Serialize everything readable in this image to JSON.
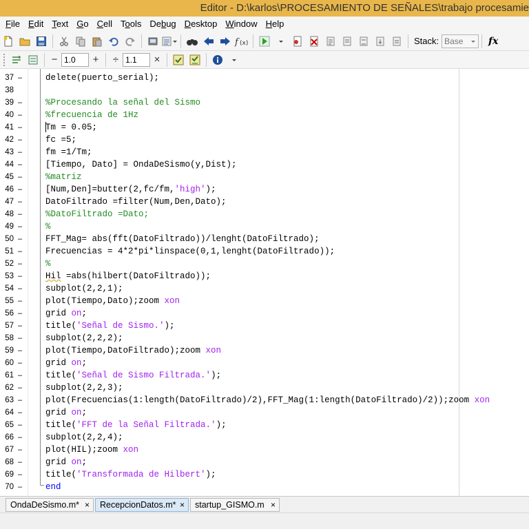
{
  "window": {
    "title": "Editor - D:\\karlos\\PROCESAMIENTO DE SEÑALES\\trabajo procesamie"
  },
  "menu": [
    {
      "pre": "",
      "u": "F",
      "post": "ile"
    },
    {
      "pre": "",
      "u": "E",
      "post": "dit"
    },
    {
      "pre": "",
      "u": "T",
      "post": "ext"
    },
    {
      "pre": "",
      "u": "G",
      "post": "o"
    },
    {
      "pre": "",
      "u": "C",
      "post": "ell"
    },
    {
      "pre": "T",
      "u": "o",
      "post": "ols"
    },
    {
      "pre": "De",
      "u": "b",
      "post": "ug"
    },
    {
      "pre": "",
      "u": "D",
      "post": "esktop"
    },
    {
      "pre": "",
      "u": "W",
      "post": "indow"
    },
    {
      "pre": "",
      "u": "H",
      "post": "elp"
    }
  ],
  "toolbar": {
    "stack_label": "Stack:",
    "stack_value": "Base",
    "fx_label": "fx"
  },
  "cell_toolbar": {
    "minus": "−",
    "value1": "1.0",
    "plus": "+",
    "divide": "÷",
    "value2": "1.1",
    "times": "×"
  },
  "code_lines": [
    {
      "n": "37",
      "parts": [
        {
          "t": "delete(puerto_serial);",
          "c": ""
        }
      ]
    },
    {
      "n": "38",
      "parts": []
    },
    {
      "n": "39",
      "parts": [
        {
          "t": "%Procesando la señal del Sismo",
          "c": "c-comment"
        }
      ]
    },
    {
      "n": "40",
      "parts": [
        {
          "t": "%frecuencia de 1Hz",
          "c": "c-comment"
        }
      ]
    },
    {
      "n": "41",
      "parts": [
        {
          "t": "Tm = 0.05;",
          "c": ""
        }
      ]
    },
    {
      "n": "42",
      "parts": [
        {
          "t": "fc =5;",
          "c": ""
        }
      ]
    },
    {
      "n": "43",
      "parts": [
        {
          "t": "fm =1/Tm;",
          "c": ""
        }
      ]
    },
    {
      "n": "44",
      "parts": [
        {
          "t": "[Tiempo, Dato] = OndaDeSismo(y,Dist);",
          "c": ""
        }
      ]
    },
    {
      "n": "45",
      "parts": [
        {
          "t": "%matriz",
          "c": "c-comment"
        }
      ]
    },
    {
      "n": "46",
      "parts": [
        {
          "t": "[Num,Den]=butter(2,fc/fm,",
          "c": ""
        },
        {
          "t": "'high'",
          "c": "c-string"
        },
        {
          "t": ");",
          "c": ""
        }
      ]
    },
    {
      "n": "47",
      "parts": [
        {
          "t": "DatoFiltrado =filter(Num,Den,Dato);",
          "c": ""
        }
      ]
    },
    {
      "n": "48",
      "parts": [
        {
          "t": "%DatoFiltrado =Dato;",
          "c": "c-comment"
        }
      ]
    },
    {
      "n": "49",
      "parts": [
        {
          "t": "%",
          "c": "c-comment"
        }
      ]
    },
    {
      "n": "50",
      "parts": [
        {
          "t": "FFT_Mag= abs(fft(DatoFiltrado))/lenght(DatoFiltrado);",
          "c": ""
        }
      ]
    },
    {
      "n": "51",
      "parts": [
        {
          "t": "Frecuencias = 4*2*pi*linspace(0,1,lenght(DatoFiltrado));",
          "c": ""
        }
      ]
    },
    {
      "n": "52",
      "parts": [
        {
          "t": "%",
          "c": "c-comment"
        }
      ]
    },
    {
      "n": "53",
      "parts": [
        {
          "t": "Hil",
          "c": "squiggle"
        },
        {
          "t": " =abs(hilbert(DatoFiltrado));",
          "c": ""
        }
      ]
    },
    {
      "n": "54",
      "parts": [
        {
          "t": "subplot(2,2,1);",
          "c": ""
        }
      ]
    },
    {
      "n": "55",
      "parts": [
        {
          "t": "plot(Tiempo,Dato);zoom ",
          "c": ""
        },
        {
          "t": "xon",
          "c": "c-arg"
        }
      ]
    },
    {
      "n": "56",
      "parts": [
        {
          "t": "grid ",
          "c": ""
        },
        {
          "t": "on",
          "c": "c-arg"
        },
        {
          "t": ";",
          "c": ""
        }
      ]
    },
    {
      "n": "57",
      "parts": [
        {
          "t": "title(",
          "c": ""
        },
        {
          "t": "'Señal de Sismo.'",
          "c": "c-string"
        },
        {
          "t": ");",
          "c": ""
        }
      ]
    },
    {
      "n": "58",
      "parts": [
        {
          "t": "subplot(2,2,2);",
          "c": ""
        }
      ]
    },
    {
      "n": "59",
      "parts": [
        {
          "t": "plot(Tiempo,DatoFiltrado);zoom ",
          "c": ""
        },
        {
          "t": "xon",
          "c": "c-arg"
        }
      ]
    },
    {
      "n": "60",
      "parts": [
        {
          "t": "grid ",
          "c": ""
        },
        {
          "t": "on",
          "c": "c-arg"
        },
        {
          "t": ";",
          "c": ""
        }
      ]
    },
    {
      "n": "61",
      "parts": [
        {
          "t": "title(",
          "c": ""
        },
        {
          "t": "'Señal de Sismo Filtrada.'",
          "c": "c-string"
        },
        {
          "t": ");",
          "c": ""
        }
      ]
    },
    {
      "n": "62",
      "parts": [
        {
          "t": "subplot(2,2,3);",
          "c": ""
        }
      ]
    },
    {
      "n": "63",
      "parts": [
        {
          "t": "plot(Frecuencias(1:length(DatoFiltrado)/2),FFT_Mag(1:length(DatoFiltrado)/2));zoom ",
          "c": ""
        },
        {
          "t": "xon",
          "c": "c-arg"
        }
      ]
    },
    {
      "n": "64",
      "parts": [
        {
          "t": "grid ",
          "c": ""
        },
        {
          "t": "on",
          "c": "c-arg"
        },
        {
          "t": ";",
          "c": ""
        }
      ]
    },
    {
      "n": "65",
      "parts": [
        {
          "t": "title(",
          "c": ""
        },
        {
          "t": "'FFT de la Señal Filtrada.'",
          "c": "c-string"
        },
        {
          "t": ");",
          "c": ""
        }
      ]
    },
    {
      "n": "66",
      "parts": [
        {
          "t": "subplot(2,2,4);",
          "c": ""
        }
      ]
    },
    {
      "n": "67",
      "parts": [
        {
          "t": "plot(HIL);zoom ",
          "c": ""
        },
        {
          "t": "xon",
          "c": "c-arg"
        }
      ]
    },
    {
      "n": "68",
      "parts": [
        {
          "t": "grid ",
          "c": ""
        },
        {
          "t": "on",
          "c": "c-arg"
        },
        {
          "t": ";",
          "c": ""
        }
      ]
    },
    {
      "n": "69",
      "parts": [
        {
          "t": "title(",
          "c": ""
        },
        {
          "t": "'Transformada de Hilbert'",
          "c": "c-string"
        },
        {
          "t": ");",
          "c": ""
        }
      ]
    },
    {
      "n": "70",
      "parts": [
        {
          "t": "end",
          "c": "c-keyword"
        }
      ]
    }
  ],
  "tabs": [
    {
      "label": "OndaDeSismo.m*",
      "active": false
    },
    {
      "label": "RecepcionDatos.m*",
      "active": true
    },
    {
      "label": "startup_GISMO.m",
      "active": false
    }
  ],
  "tab_close": "×",
  "colors": {
    "title_bar": "#e8b64a",
    "comment": "#228b22",
    "string": "#a020f0",
    "keyword": "#0000ff",
    "active_tab": "#dbe8f6"
  }
}
